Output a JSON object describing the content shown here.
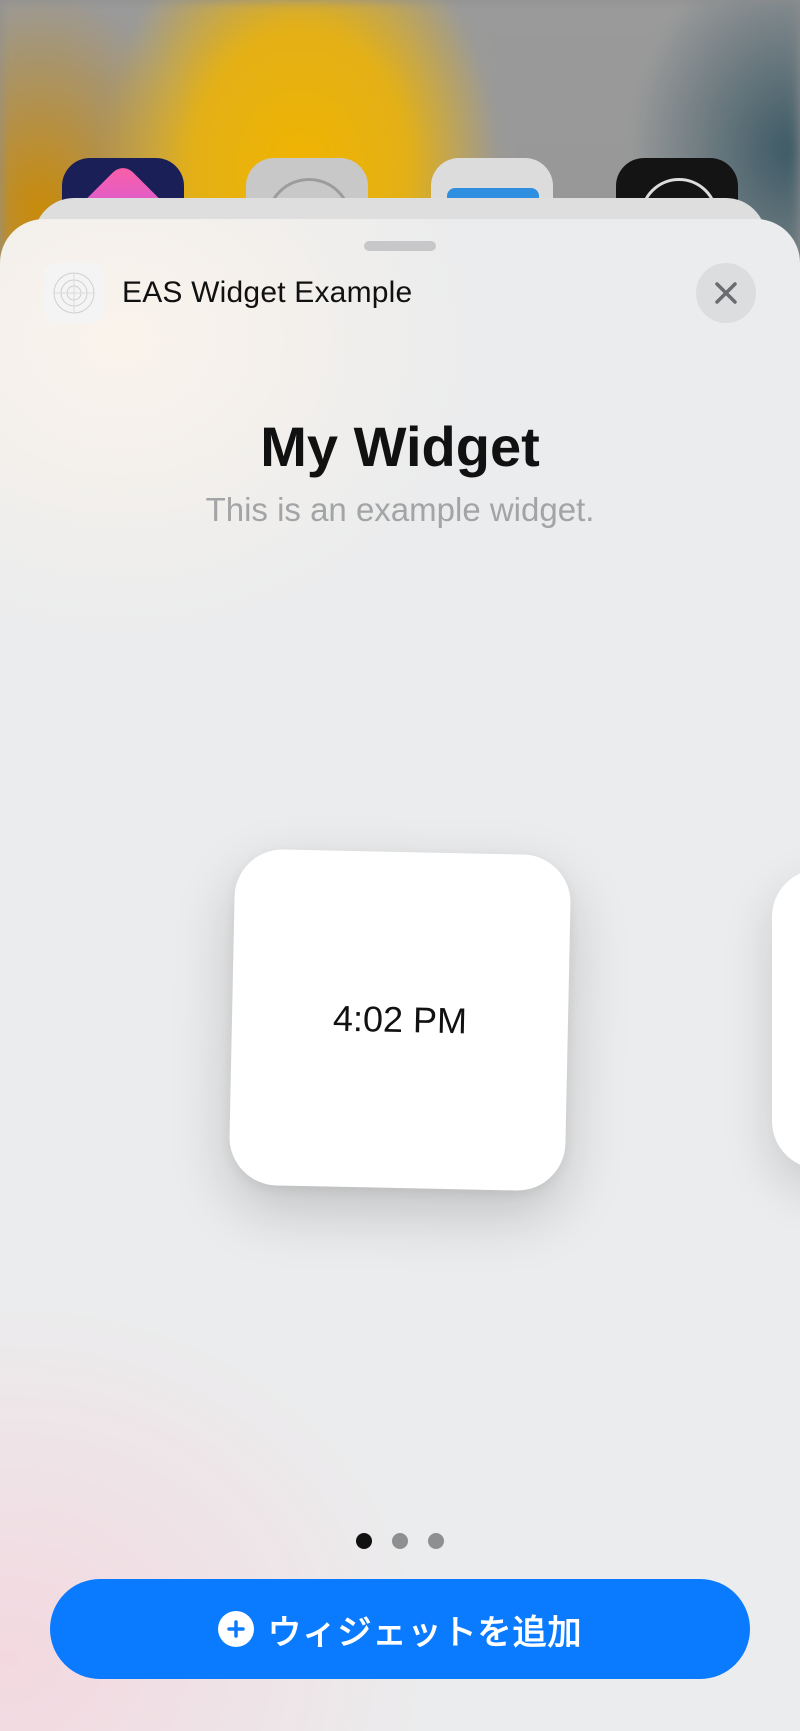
{
  "header": {
    "app_name": "EAS Widget Example",
    "app_icon": "app-placeholder-icon",
    "close_icon": "close-icon"
  },
  "widget": {
    "title": "My Widget",
    "description": "This is an example widget.",
    "preview_time": "4:02 PM"
  },
  "pagination": {
    "current": 1,
    "total": 3
  },
  "add_button": {
    "label": "ウィジェットを追加",
    "icon": "plus-circle-icon"
  },
  "colors": {
    "accent": "#0a7aff",
    "sheet_background": "#ebeced",
    "description_text": "#a3a4a6"
  }
}
